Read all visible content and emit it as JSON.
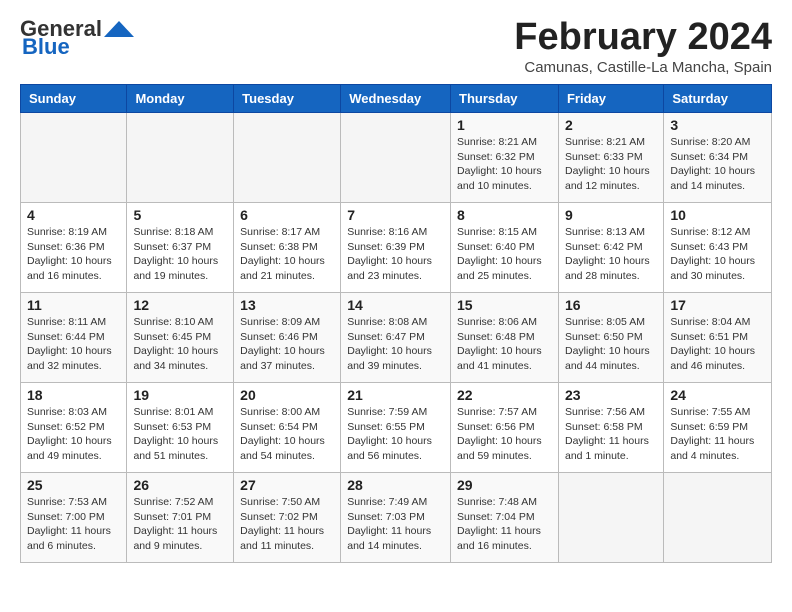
{
  "header": {
    "logo_general": "General",
    "logo_blue": "Blue",
    "month_title": "February 2024",
    "location": "Camunas, Castille-La Mancha, Spain"
  },
  "days_of_week": [
    "Sunday",
    "Monday",
    "Tuesday",
    "Wednesday",
    "Thursday",
    "Friday",
    "Saturday"
  ],
  "weeks": [
    [
      {
        "day": "",
        "info": ""
      },
      {
        "day": "",
        "info": ""
      },
      {
        "day": "",
        "info": ""
      },
      {
        "day": "",
        "info": ""
      },
      {
        "day": "1",
        "info": "Sunrise: 8:21 AM\nSunset: 6:32 PM\nDaylight: 10 hours\nand 10 minutes."
      },
      {
        "day": "2",
        "info": "Sunrise: 8:21 AM\nSunset: 6:33 PM\nDaylight: 10 hours\nand 12 minutes."
      },
      {
        "day": "3",
        "info": "Sunrise: 8:20 AM\nSunset: 6:34 PM\nDaylight: 10 hours\nand 14 minutes."
      }
    ],
    [
      {
        "day": "4",
        "info": "Sunrise: 8:19 AM\nSunset: 6:36 PM\nDaylight: 10 hours\nand 16 minutes."
      },
      {
        "day": "5",
        "info": "Sunrise: 8:18 AM\nSunset: 6:37 PM\nDaylight: 10 hours\nand 19 minutes."
      },
      {
        "day": "6",
        "info": "Sunrise: 8:17 AM\nSunset: 6:38 PM\nDaylight: 10 hours\nand 21 minutes."
      },
      {
        "day": "7",
        "info": "Sunrise: 8:16 AM\nSunset: 6:39 PM\nDaylight: 10 hours\nand 23 minutes."
      },
      {
        "day": "8",
        "info": "Sunrise: 8:15 AM\nSunset: 6:40 PM\nDaylight: 10 hours\nand 25 minutes."
      },
      {
        "day": "9",
        "info": "Sunrise: 8:13 AM\nSunset: 6:42 PM\nDaylight: 10 hours\nand 28 minutes."
      },
      {
        "day": "10",
        "info": "Sunrise: 8:12 AM\nSunset: 6:43 PM\nDaylight: 10 hours\nand 30 minutes."
      }
    ],
    [
      {
        "day": "11",
        "info": "Sunrise: 8:11 AM\nSunset: 6:44 PM\nDaylight: 10 hours\nand 32 minutes."
      },
      {
        "day": "12",
        "info": "Sunrise: 8:10 AM\nSunset: 6:45 PM\nDaylight: 10 hours\nand 34 minutes."
      },
      {
        "day": "13",
        "info": "Sunrise: 8:09 AM\nSunset: 6:46 PM\nDaylight: 10 hours\nand 37 minutes."
      },
      {
        "day": "14",
        "info": "Sunrise: 8:08 AM\nSunset: 6:47 PM\nDaylight: 10 hours\nand 39 minutes."
      },
      {
        "day": "15",
        "info": "Sunrise: 8:06 AM\nSunset: 6:48 PM\nDaylight: 10 hours\nand 41 minutes."
      },
      {
        "day": "16",
        "info": "Sunrise: 8:05 AM\nSunset: 6:50 PM\nDaylight: 10 hours\nand 44 minutes."
      },
      {
        "day": "17",
        "info": "Sunrise: 8:04 AM\nSunset: 6:51 PM\nDaylight: 10 hours\nand 46 minutes."
      }
    ],
    [
      {
        "day": "18",
        "info": "Sunrise: 8:03 AM\nSunset: 6:52 PM\nDaylight: 10 hours\nand 49 minutes."
      },
      {
        "day": "19",
        "info": "Sunrise: 8:01 AM\nSunset: 6:53 PM\nDaylight: 10 hours\nand 51 minutes."
      },
      {
        "day": "20",
        "info": "Sunrise: 8:00 AM\nSunset: 6:54 PM\nDaylight: 10 hours\nand 54 minutes."
      },
      {
        "day": "21",
        "info": "Sunrise: 7:59 AM\nSunset: 6:55 PM\nDaylight: 10 hours\nand 56 minutes."
      },
      {
        "day": "22",
        "info": "Sunrise: 7:57 AM\nSunset: 6:56 PM\nDaylight: 10 hours\nand 59 minutes."
      },
      {
        "day": "23",
        "info": "Sunrise: 7:56 AM\nSunset: 6:58 PM\nDaylight: 11 hours\nand 1 minute."
      },
      {
        "day": "24",
        "info": "Sunrise: 7:55 AM\nSunset: 6:59 PM\nDaylight: 11 hours\nand 4 minutes."
      }
    ],
    [
      {
        "day": "25",
        "info": "Sunrise: 7:53 AM\nSunset: 7:00 PM\nDaylight: 11 hours\nand 6 minutes."
      },
      {
        "day": "26",
        "info": "Sunrise: 7:52 AM\nSunset: 7:01 PM\nDaylight: 11 hours\nand 9 minutes."
      },
      {
        "day": "27",
        "info": "Sunrise: 7:50 AM\nSunset: 7:02 PM\nDaylight: 11 hours\nand 11 minutes."
      },
      {
        "day": "28",
        "info": "Sunrise: 7:49 AM\nSunset: 7:03 PM\nDaylight: 11 hours\nand 14 minutes."
      },
      {
        "day": "29",
        "info": "Sunrise: 7:48 AM\nSunset: 7:04 PM\nDaylight: 11 hours\nand 16 minutes."
      },
      {
        "day": "",
        "info": ""
      },
      {
        "day": "",
        "info": ""
      }
    ]
  ]
}
